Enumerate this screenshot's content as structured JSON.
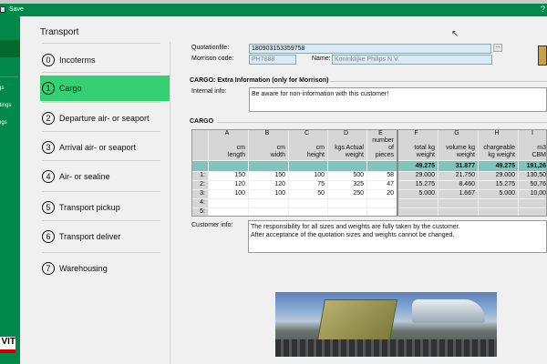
{
  "titlebar": {
    "save_label": "Save",
    "help": "?"
  },
  "sidebar": {
    "items": [
      "gs",
      "ttings",
      "ngs"
    ],
    "logo": "VIT"
  },
  "nav": {
    "title": "Transport",
    "items": [
      {
        "num": "0",
        "label": "Incoterms"
      },
      {
        "num": "1",
        "label": "Cargo",
        "active": true
      },
      {
        "num": "2",
        "label": "Departure air- or seaport"
      },
      {
        "num": "3",
        "label": "Arrival air- or seaport"
      },
      {
        "num": "4",
        "label": "Air- or sealine"
      },
      {
        "num": "5",
        "label": "Transport pickup"
      },
      {
        "num": "6",
        "label": "Transport deliver"
      },
      {
        "num": "7",
        "label": "Warehousing"
      }
    ]
  },
  "form": {
    "quotation_label": "Quotationfile:",
    "quotation_value": "180903153359758",
    "browse": "...",
    "morrison_label": "Morrison code:",
    "morrison_value": "PH7888",
    "name_label": "Name:",
    "name_value": "Koninklijke Philips N.V.",
    "extra_title": "CARGO: Extra Information (only for Morrison)",
    "internal_label": "Internal info:",
    "internal_value": "Be aware for non-information with this customer!",
    "cargo_title": "CARGO",
    "customer_label": "Customer info:",
    "customer_value": [
      "The responsibility for all sizes and weights are fully taken by the customer.",
      "After acceptance of the quotation sizes and weights cannot be changed."
    ]
  },
  "grid": {
    "columns": [
      {
        "letter": "A",
        "label": [
          "cm",
          "length"
        ]
      },
      {
        "letter": "B",
        "label": [
          "cm",
          "width"
        ]
      },
      {
        "letter": "C",
        "label": [
          "cm",
          "height"
        ]
      },
      {
        "letter": "D",
        "label": [
          "kgs Actual",
          "weight"
        ]
      },
      {
        "letter": "E",
        "label": [
          "number",
          "of",
          "pieces"
        ]
      },
      {
        "letter": "F",
        "label": [
          "total kg",
          "weight"
        ]
      },
      {
        "letter": "G",
        "label": [
          "volume kg",
          "weight"
        ]
      },
      {
        "letter": "H",
        "label": [
          "chargeable",
          "kg weight"
        ]
      },
      {
        "letter": "I",
        "label": [
          "m3",
          "CBM"
        ]
      }
    ],
    "totals": [
      "",
      "",
      "",
      "",
      "",
      "49.275",
      "31.877",
      "49.275",
      "191,26"
    ],
    "rows": [
      {
        "id": "1:",
        "cells": [
          "150",
          "150",
          "100",
          "500",
          "58",
          "29.000",
          "21.750",
          "29.000",
          "130,50"
        ]
      },
      {
        "id": "2:",
        "cells": [
          "120",
          "120",
          "75",
          "325",
          "47",
          "15.275",
          "8.460",
          "15.275",
          "50,76"
        ]
      },
      {
        "id": "3:",
        "cells": [
          "100",
          "100",
          "50",
          "250",
          "20",
          "5.000",
          "1.667",
          "5.000",
          "10,00"
        ]
      },
      {
        "id": "4:",
        "cells": [
          "",
          "",
          "",
          "",
          "",
          "",
          "",
          "",
          ""
        ]
      },
      {
        "id": "5:",
        "cells": [
          "",
          "",
          "",
          "",
          "",
          "",
          "",
          "",
          ""
        ]
      }
    ],
    "colors": {
      "totals_bg": "#7fc4bd",
      "editable_bg": "#ffffff",
      "computed_bg": "#d6d6d6"
    }
  },
  "colors": {
    "brand_green": "#00894a",
    "active_nav": "#36d074"
  }
}
